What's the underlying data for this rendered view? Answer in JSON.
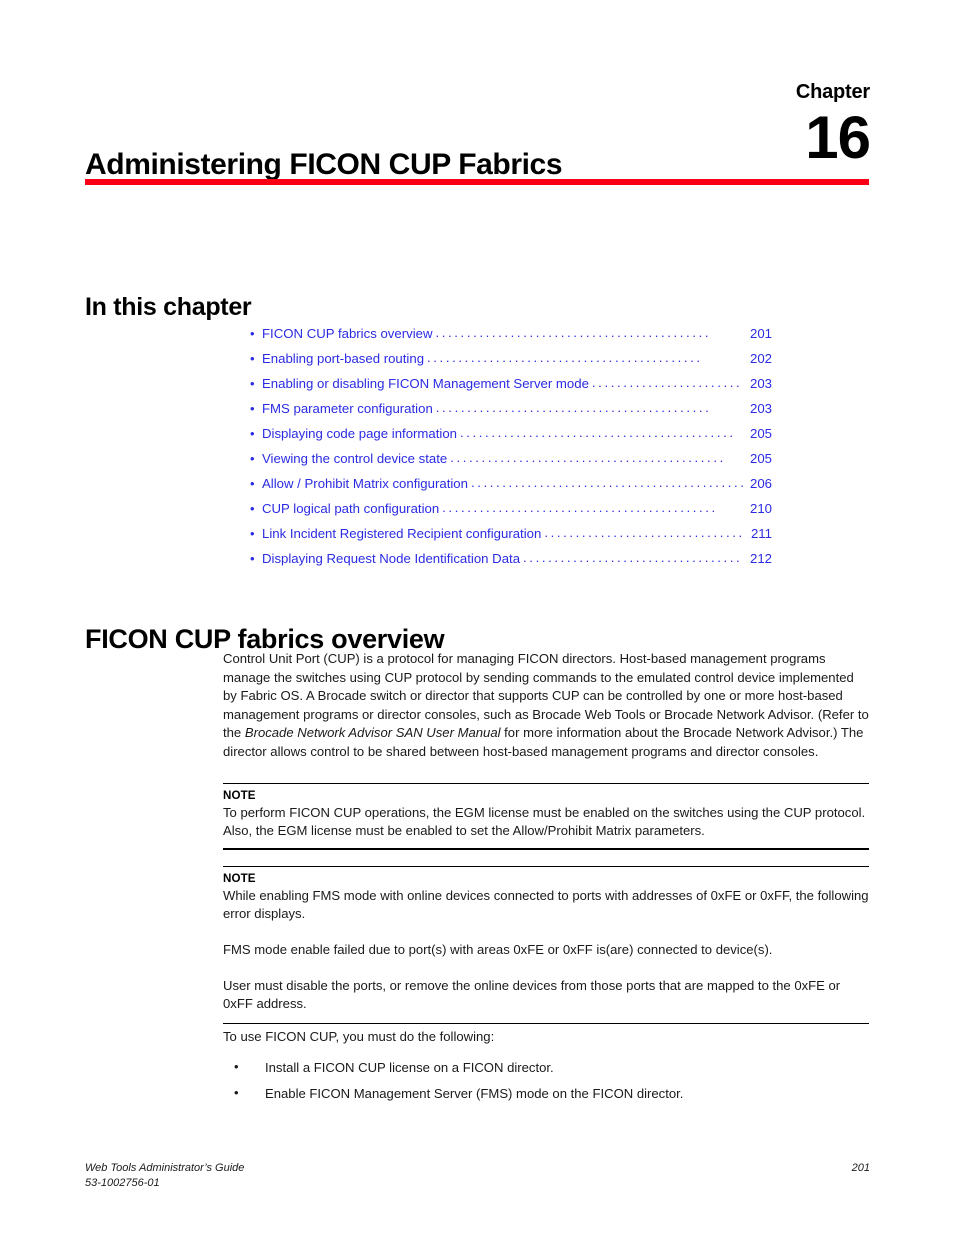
{
  "header": {
    "chapter_word": "Chapter",
    "chapter_number": "16",
    "chapter_title": "Administering FICON CUP Fabrics",
    "rule_color": "#f90015"
  },
  "in_this_chapter": {
    "heading": "In this chapter",
    "link_color": "#2b2be4",
    "items": [
      {
        "bullet": "•",
        "label": "FICON CUP fabrics overview",
        "dots": "............................................",
        "page": "201"
      },
      {
        "bullet": "•",
        "label": "Enabling port-based routing",
        "dots": "............................................",
        "page": "202"
      },
      {
        "bullet": "•",
        "label": "Enabling or disabling FICON Management Server mode",
        "dots": "............................................",
        "page": "203"
      },
      {
        "bullet": "•",
        "label": "FMS parameter configuration",
        "dots": "............................................",
        "page": "203"
      },
      {
        "bullet": "•",
        "label": "Displaying code page information",
        "dots": "............................................",
        "page": "205"
      },
      {
        "bullet": "•",
        "label": "Viewing the control device state",
        "dots": "............................................",
        "page": "205"
      },
      {
        "bullet": "•",
        "label": "Allow / Prohibit Matrix configuration",
        "dots": "............................................",
        "page": "206"
      },
      {
        "bullet": "•",
        "label": "CUP logical path configuration",
        "dots": "............................................",
        "page": "210"
      },
      {
        "bullet": "•",
        "label": "Link Incident Registered Recipient configuration",
        "dots": "............................................",
        "page": "211"
      },
      {
        "bullet": "•",
        "label": "Displaying Request Node Identification Data",
        "dots": "............................................",
        "page": "212"
      }
    ]
  },
  "overview": {
    "heading": "FICON CUP fabrics overview",
    "paragraph_part1": "Control Unit Port (CUP) is a protocol for managing FICON directors. Host-based management programs manage the switches using CUP protocol by sending commands to the emulated control device implemented by Fabric OS. A Brocade switch or director that supports CUP can be controlled by one or more host-based management programs or director consoles, such as Brocade Web Tools or Brocade Network Advisor. (Refer to the ",
    "paragraph_italic": "Brocade Network Advisor SAN User Manual",
    "paragraph_part2": " for more information about the Brocade Network Advisor.) The director allows control to be shared between host-based management programs and director consoles."
  },
  "note1": {
    "title": "NOTE",
    "body": "To perform FICON CUP operations, the EGM license must be enabled on the switches using the CUP protocol. Also, the EGM license must be enabled to set the Allow/Prohibit Matrix parameters."
  },
  "note2": {
    "title": "NOTE",
    "body": "While enabling FMS mode with online devices connected to ports with addresses of 0xFE or 0xFF, the following error displays.",
    "error_message": "FMS mode enable failed due to port(s) with areas 0xFE or 0xFF is(are) connected to device(s).",
    "remedy": "User must disable the ports, or remove the online devices from those ports that are mapped to the 0xFE or 0xFF address."
  },
  "requirements": {
    "intro": "To use FICON CUP, you must do the following:",
    "bullet_glyph": "•",
    "items": [
      "Install a FICON CUP license on a FICON director.",
      "Enable FICON Management Server (FMS) mode on the FICON director."
    ]
  },
  "footer": {
    "guide_title": "Web Tools Administrator’s Guide",
    "doc_number": "53-1002756-01",
    "page_number": "201"
  }
}
